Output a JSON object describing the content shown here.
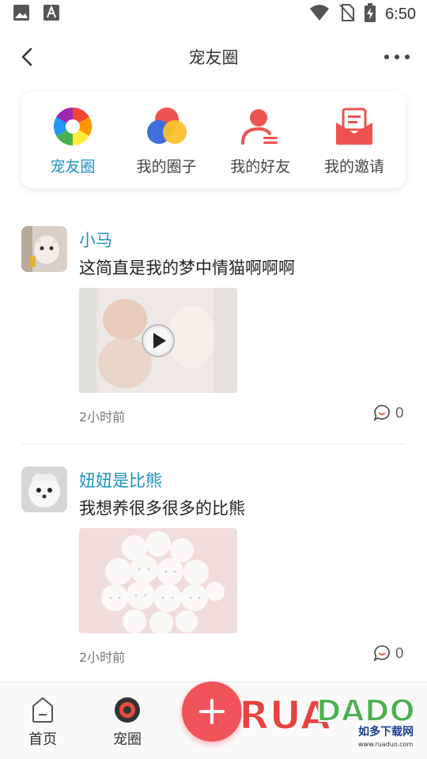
{
  "status_bar": {
    "time": "6:50"
  },
  "header": {
    "title": "宠友圈"
  },
  "quick_nav": [
    {
      "label": "宠友圈",
      "active": true
    },
    {
      "label": "我的圈子",
      "active": false
    },
    {
      "label": "我的好友",
      "active": false
    },
    {
      "label": "我的邀请",
      "active": false
    }
  ],
  "posts": [
    {
      "user": "小马",
      "text": "这简直是我的梦中情猫啊啊啊",
      "media": "video",
      "time": "2小时前",
      "comments": "0"
    },
    {
      "user": "妞妞是比熊",
      "text": "我想养很多很多的比熊",
      "media": "image",
      "time": "2小时前",
      "comments": "0"
    }
  ],
  "tab_bar": {
    "home_label": "首页",
    "circle_label": "宠圈"
  },
  "watermark": {
    "brand": "RUANDADO",
    "cn": "如多下载网",
    "url": "www.ruaduo.com"
  },
  "colors": {
    "accent": "#1e90c4",
    "fab": "#f0545a"
  }
}
